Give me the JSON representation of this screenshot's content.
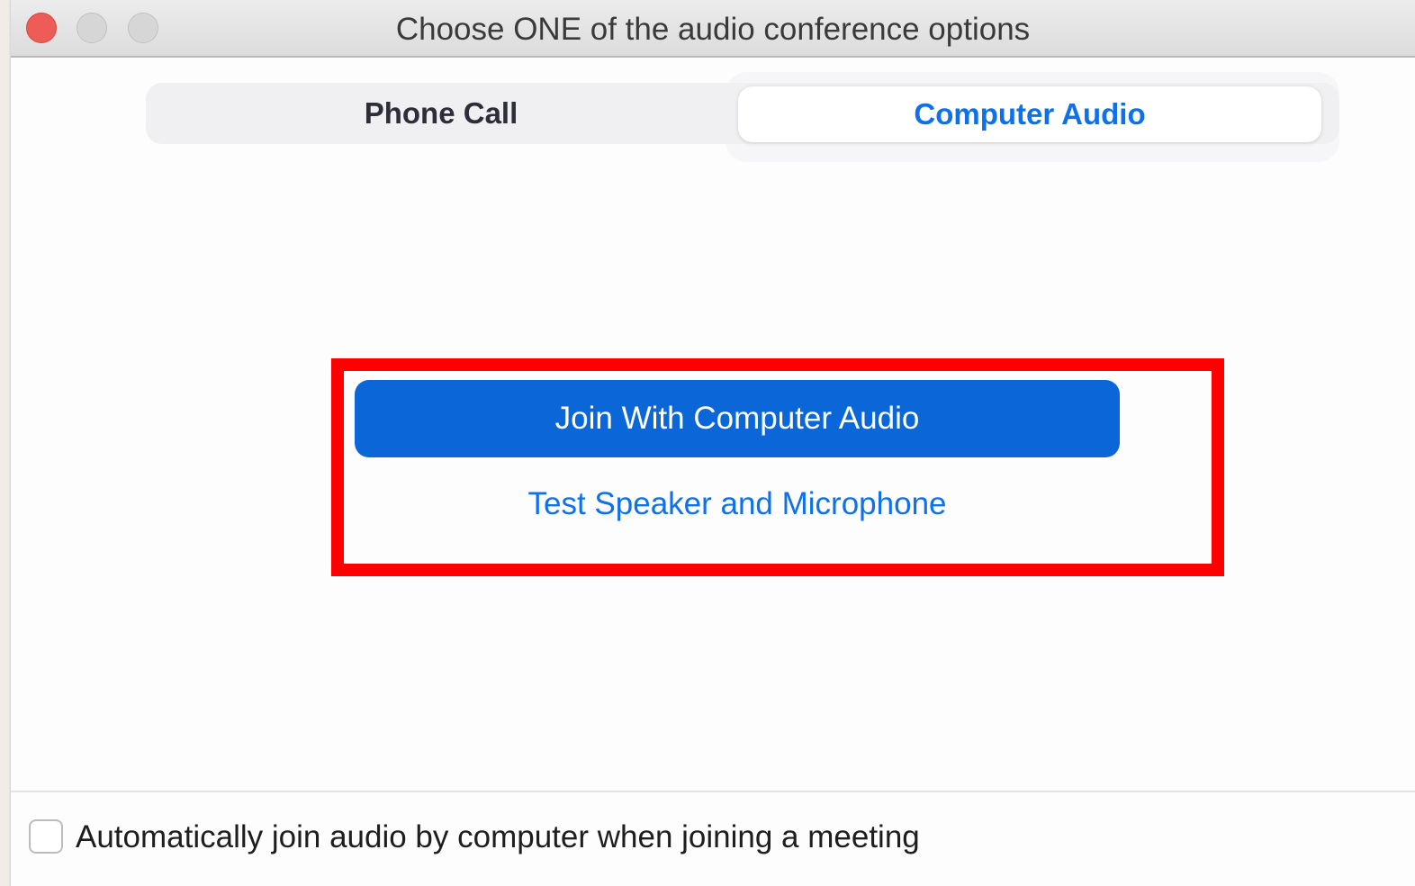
{
  "window": {
    "title": "Choose ONE of the audio conference options"
  },
  "tabs": {
    "phone_call": "Phone Call",
    "computer_audio": "Computer Audio",
    "selected": "Computer Audio"
  },
  "main": {
    "join_button_label": "Join With Computer Audio",
    "test_link_label": "Test Speaker and Microphone"
  },
  "footer": {
    "auto_join_label": "Automatically join audio by computer when joining a meeting",
    "auto_join_checked": false
  },
  "colors": {
    "accent": "#0e71eb",
    "primary_button": "#0b67d8",
    "highlight_annotation": "#ff0000",
    "close_button": "#ee5c57"
  },
  "icons": {
    "close": "close-window-icon",
    "minimize": "minimize-window-icon",
    "maximize": "maximize-window-icon"
  }
}
